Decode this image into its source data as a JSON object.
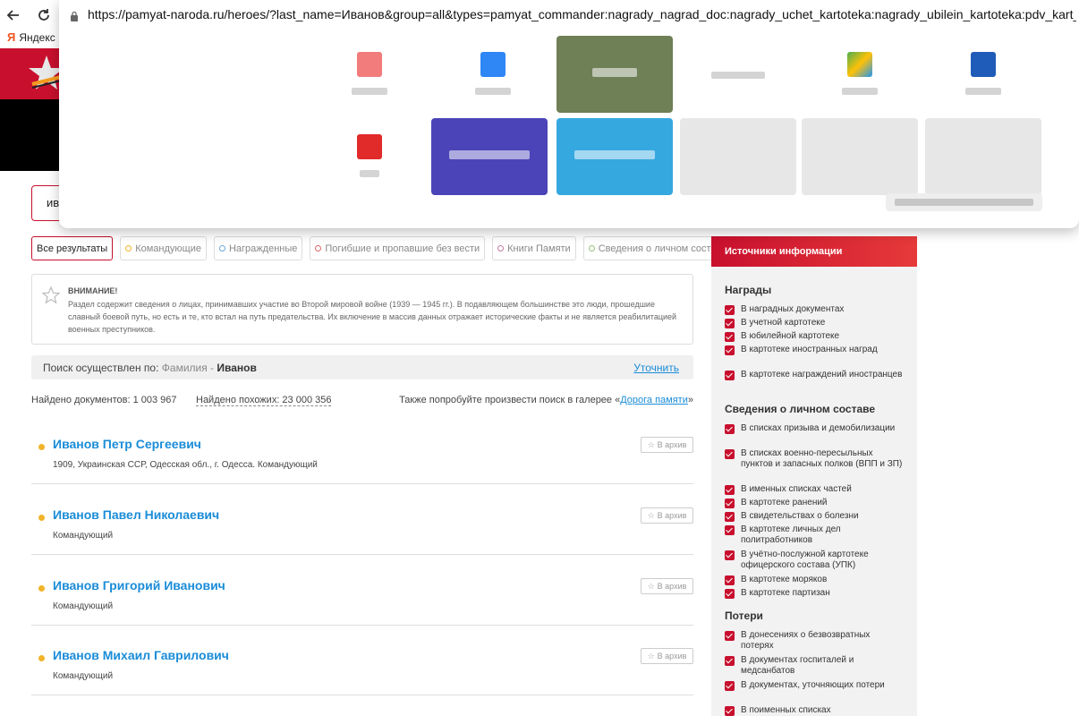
{
  "browser": {
    "url": "https://pamyat-naroda.ru/heroes/?last_name=Иванов&group=all&types=pamyat_commander:nagrady_nagrad_doc:nagrady_uchet_kartoteka:nagrady_ubilein_kartoteka:pdv_kart_in:pdv_kart_in_in",
    "bookmark": "Яндекс",
    "bookmark_glyph": "Я"
  },
  "search": {
    "value": "ив"
  },
  "tabs": [
    {
      "label": "Все результаты",
      "dot_color": ""
    },
    {
      "label": "Командующие",
      "dot_color": "#f0b429"
    },
    {
      "label": "Награжденные",
      "dot_color": "#6fa8dc"
    },
    {
      "label": "Погибшие и пропавшие без вести",
      "dot_color": "#e06666"
    },
    {
      "label": "Книги Памяти",
      "dot_color": "#c27ba0"
    },
    {
      "label": "Сведения о личном составе",
      "dot_color": "#93c47d"
    }
  ],
  "warning": {
    "title": "ВНИМАНИЕ!",
    "text": "Раздел содержит сведения о лицах, принимавших участие во Второй мировой войне (1939 — 1945 гг.). В подавляющем большинстве это люди, прошедшие славный боевой путь, но есть и те, кто встал на путь предательства. Их включение в массив данных отражает исторические факты и не является реабилитацией военных преступников."
  },
  "search_info": {
    "prefix": "Поиск осуществлен по:",
    "field": "Фамилия",
    "sep": " - ",
    "value": "Иванов",
    "refine": "Уточнить"
  },
  "counts": {
    "found": "Найдено документов: 1 003 967",
    "similar": "Найдено похожих: 23 000 356",
    "gallery_prefix": "Также попробуйте произвести поиск в галерее «",
    "gallery_link": "Дорога памяти",
    "gallery_suffix": "»"
  },
  "results": [
    {
      "name": "Иванов Петр Сергеевич",
      "desc": "1909, Украинская ССР, Одесская обл., г. Одесса. Командующий",
      "archive": "В архив"
    },
    {
      "name": "Иванов Павел Николаевич",
      "desc": "Командующий",
      "archive": "В архив"
    },
    {
      "name": "Иванов Григорий Иванович",
      "desc": "Командующий",
      "archive": "В архив"
    },
    {
      "name": "Иванов Михаил Гаврилович",
      "desc": "Командующий",
      "archive": "В архив"
    }
  ],
  "sidebar": {
    "title": "Источники информации",
    "groups": [
      {
        "title": "Награды",
        "items": [
          "В наградных документах",
          "В учетной картотеке",
          "В юбилейной картотеке",
          "В картотеке иностранных наград",
          "В картотеке награждений иностранцев"
        ]
      },
      {
        "title": "Сведения о личном составе",
        "items": [
          "В списках призыва и демобилизации",
          "В списках военно-пересыльных пунктов и запасных полков (ВПП и ЗП)",
          "В именных списках частей",
          "В картотеке ранений",
          "В свидетельствах о болезни",
          "В картотеке личных дел политработников",
          "В учётно-послужной картотеке офицерского состава (УПК)",
          "В картотеке моряков",
          "В картотеке партизан"
        ]
      },
      {
        "title": "Потери",
        "items": [
          "В донесениях о безвозвратных потерях",
          "В документах госпиталей и медсанбатов",
          "В документах, уточняющих потери",
          "В поименных списках"
        ]
      }
    ]
  },
  "colors": {
    "brand_red": "#c8102e",
    "link_blue": "#1a8cd8",
    "commander_dot": "#f0b429"
  }
}
